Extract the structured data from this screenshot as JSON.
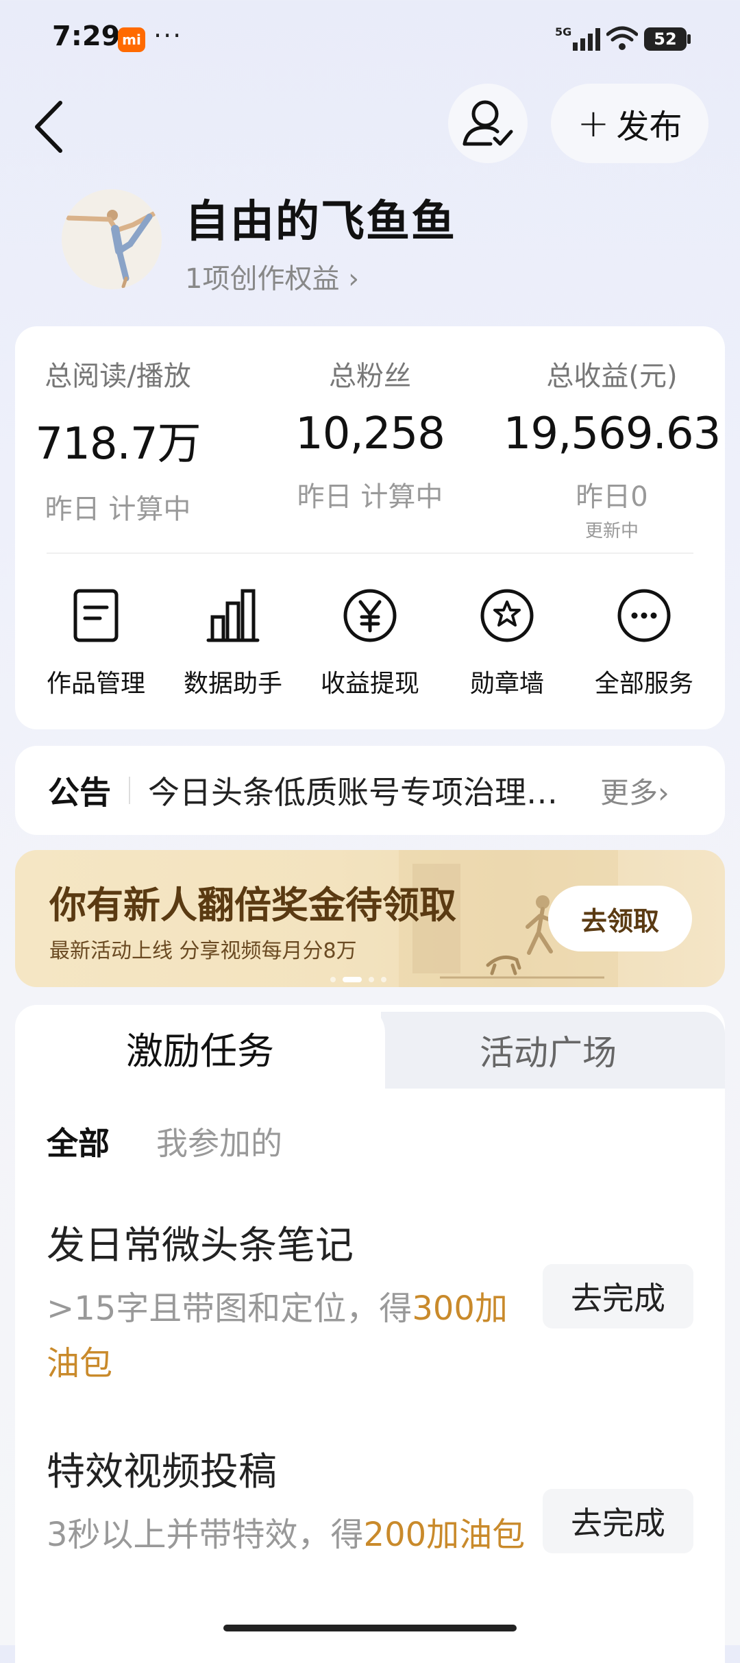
{
  "status_bar": {
    "time": "7:29",
    "mi_badge": "mi",
    "more_dots": "···",
    "network": "5G",
    "battery": "52"
  },
  "header": {
    "publish_label": "发布",
    "publish_plus": "+"
  },
  "profile": {
    "username": "自由的飞鱼鱼",
    "rights": "1项创作权益 ›"
  },
  "stats": [
    {
      "label": "总阅读/播放",
      "value": "718.7万",
      "sub": "昨日 计算中"
    },
    {
      "label": "总粉丝",
      "value": "10,258",
      "sub": "昨日 计算中"
    },
    {
      "label": "总收益(元)",
      "value": "19,569.63",
      "sub": "昨日0",
      "sub2": "更新中"
    }
  ],
  "services": [
    {
      "label": "作品管理",
      "icon": "document-icon"
    },
    {
      "label": "数据助手",
      "icon": "bar-chart-icon"
    },
    {
      "label": "收益提现",
      "icon": "yen-icon"
    },
    {
      "label": "勋章墙",
      "icon": "medal-star-icon"
    },
    {
      "label": "全部服务",
      "icon": "more-icon"
    }
  ],
  "notice": {
    "title": "公告",
    "text": "今日头条低质账号专项治理公告",
    "more": "更多›"
  },
  "banner": {
    "title": "你有新人翻倍奖金待领取",
    "subtitle": "最新活动上线 分享视频每月分8万",
    "button": "去领取"
  },
  "tasks_tabs": {
    "active": "激励任务",
    "inactive": "活动广场"
  },
  "filters": {
    "all": "全部",
    "mine": "我参加的"
  },
  "tasks": [
    {
      "title": "发日常微头条笔记",
      "desc_prefix": ">15字且带图和定位，得",
      "reward": "300加油包",
      "button": "去完成"
    },
    {
      "title": "特效视频投稿",
      "desc_prefix": "3秒以上并带特效，得",
      "reward": "200加油包",
      "button": "去完成"
    }
  ],
  "colors": {
    "accent_gold": "#c98a2b",
    "banner_text": "#5a3a12",
    "mi_orange": "#ff6a00"
  }
}
